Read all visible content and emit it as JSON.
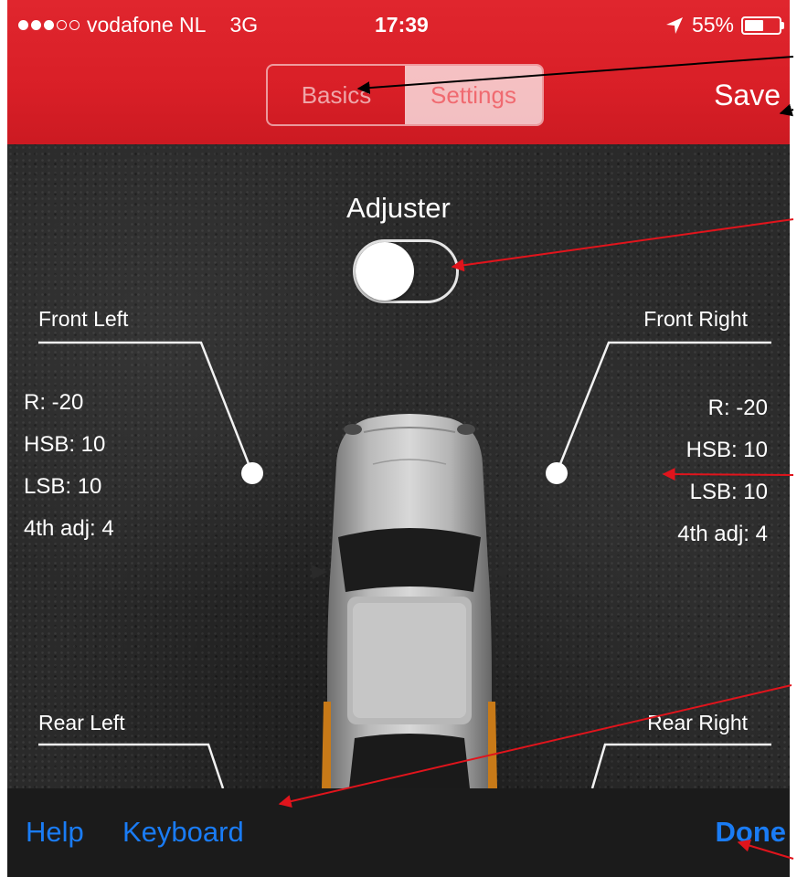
{
  "status_bar": {
    "carrier": "vodafone NL",
    "network": "3G",
    "time": "17:39",
    "battery": "55%",
    "battery_level": 0.55,
    "location_icon": "location-arrow-icon"
  },
  "header": {
    "tabs": [
      {
        "label": "Basics",
        "active": false
      },
      {
        "label": "Settings",
        "active": true
      }
    ],
    "save_label": "Save",
    "color": "#d91f27"
  },
  "main": {
    "adjuster": {
      "label": "Adjuster",
      "on": false
    },
    "wheels": {
      "front_left": {
        "title": "Front Left",
        "r": "R: -20",
        "hsb": "HSB: 10",
        "lsb": "LSB: 10",
        "adj": "4th adj: 4"
      },
      "front_right": {
        "title": "Front Right",
        "r": "R: -20",
        "hsb": "HSB: 10",
        "lsb": "LSB: 10",
        "adj": "4th adj: 4"
      },
      "rear_left": {
        "title": "Rear Left"
      },
      "rear_right": {
        "title": "Rear Right"
      }
    }
  },
  "toolbar": {
    "help_label": "Help",
    "keyboard_label": "Keyboard",
    "done_label": "Done",
    "accent": "#1a7cf5"
  }
}
